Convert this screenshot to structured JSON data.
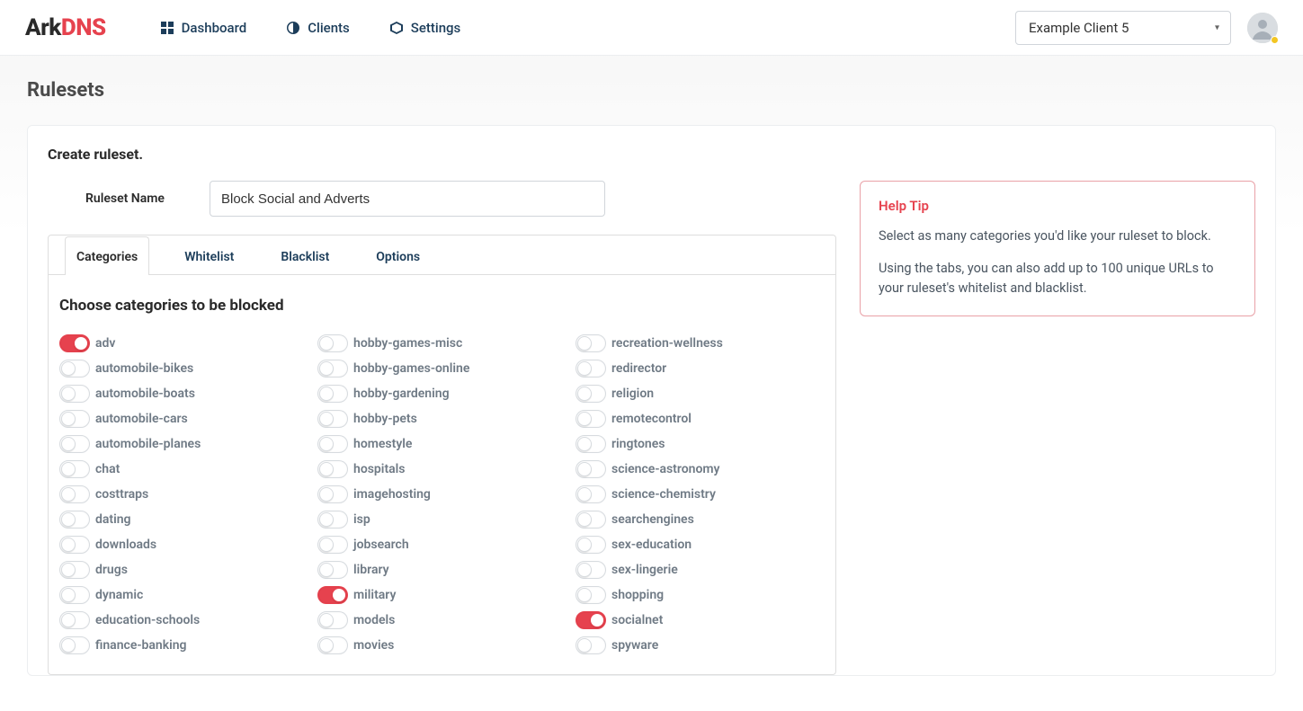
{
  "brand": {
    "part1": "Ark",
    "part2": "DNS"
  },
  "nav": {
    "dashboard": "Dashboard",
    "clients": "Clients",
    "settings": "Settings"
  },
  "header": {
    "client_selected": "Example Client 5"
  },
  "page": {
    "title": "Rulesets"
  },
  "form": {
    "heading": "Create ruleset.",
    "name_label": "Ruleset Name",
    "name_value": "Block Social and Adverts"
  },
  "tabs": {
    "categories": "Categories",
    "whitelist": "Whitelist",
    "blacklist": "Blacklist",
    "options": "Options"
  },
  "categories_section": {
    "subheading": "Choose categories to be blocked"
  },
  "categories": [
    [
      "adv",
      true
    ],
    [
      "automobile-bikes",
      false
    ],
    [
      "automobile-boats",
      false
    ],
    [
      "automobile-cars",
      false
    ],
    [
      "automobile-planes",
      false
    ],
    [
      "chat",
      false
    ],
    [
      "costtraps",
      false
    ],
    [
      "dating",
      false
    ],
    [
      "downloads",
      false
    ],
    [
      "drugs",
      false
    ],
    [
      "dynamic",
      false
    ],
    [
      "education-schools",
      false
    ],
    [
      "finance-banking",
      false
    ],
    [
      "hobby-games-misc",
      false
    ],
    [
      "hobby-games-online",
      false
    ],
    [
      "hobby-gardening",
      false
    ],
    [
      "hobby-pets",
      false
    ],
    [
      "homestyle",
      false
    ],
    [
      "hospitals",
      false
    ],
    [
      "imagehosting",
      false
    ],
    [
      "isp",
      false
    ],
    [
      "jobsearch",
      false
    ],
    [
      "library",
      false
    ],
    [
      "military",
      true
    ],
    [
      "models",
      false
    ],
    [
      "movies",
      false
    ],
    [
      "recreation-wellness",
      false
    ],
    [
      "redirector",
      false
    ],
    [
      "religion",
      false
    ],
    [
      "remotecontrol",
      false
    ],
    [
      "ringtones",
      false
    ],
    [
      "science-astronomy",
      false
    ],
    [
      "science-chemistry",
      false
    ],
    [
      "searchengines",
      false
    ],
    [
      "sex-education",
      false
    ],
    [
      "sex-lingerie",
      false
    ],
    [
      "shopping",
      false
    ],
    [
      "socialnet",
      true
    ],
    [
      "spyware",
      false
    ]
  ],
  "tip": {
    "title": "Help Tip",
    "p1": "Select as many categories you'd like your ruleset to block.",
    "p2": "Using the tabs, you can also add up to 100 unique URLs to your ruleset's whitelist and blacklist."
  }
}
